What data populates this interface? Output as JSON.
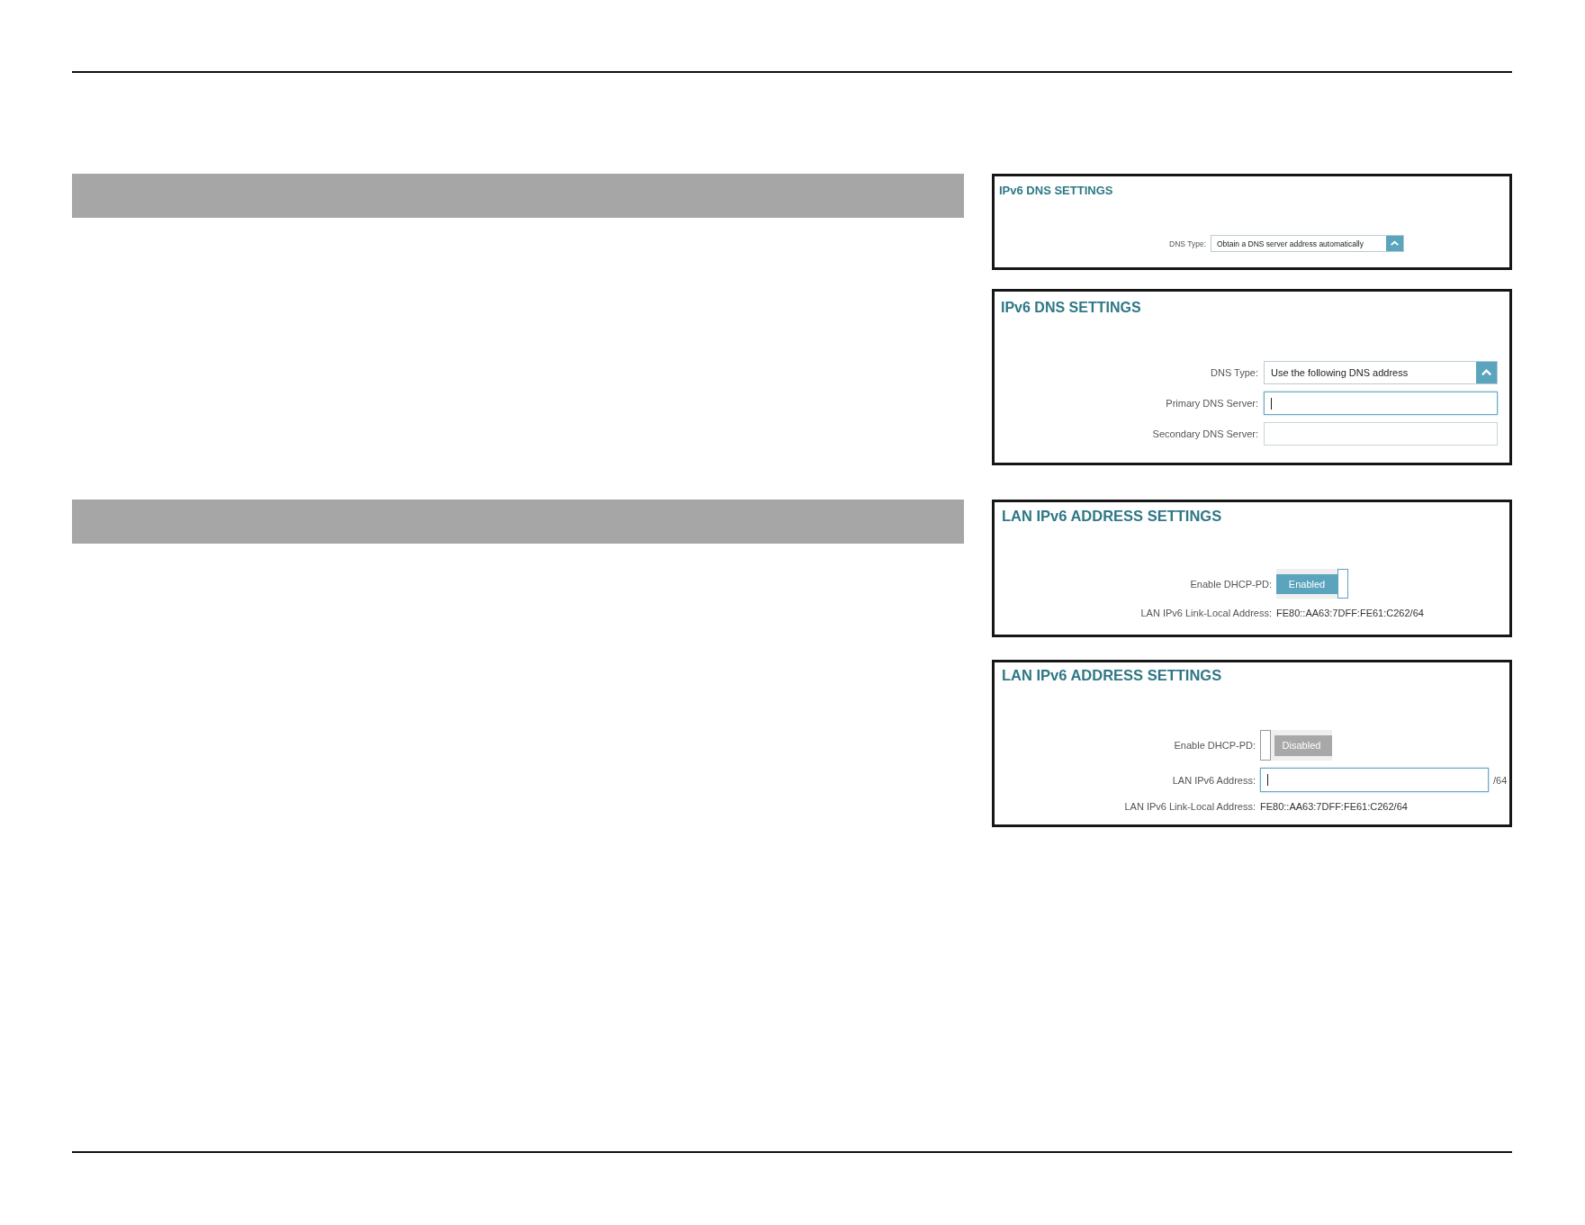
{
  "sections": [
    {
      "panels": [
        {
          "title": "IPv6 DNS SETTINGS",
          "rows": [
            {
              "kind": "select",
              "label": "DNS Type:",
              "value": "Obtain a DNS server address automatically"
            }
          ]
        },
        {
          "title": "IPv6 DNS SETTINGS",
          "rows": [
            {
              "kind": "select",
              "label": "DNS Type:",
              "value": "Use the following DNS address"
            },
            {
              "kind": "input",
              "label": "Primary DNS Server:",
              "focused": true
            },
            {
              "kind": "input",
              "label": "Secondary DNS Server:",
              "focused": false
            }
          ]
        }
      ]
    },
    {
      "panels": [
        {
          "title": "LAN IPv6 ADDRESS SETTINGS",
          "rows": [
            {
              "kind": "toggle",
              "label": "Enable DHCP-PD:",
              "on": true,
              "text": "Enabled"
            },
            {
              "kind": "info",
              "label": "LAN IPv6 Link-Local Address:",
              "value": "FE80::AA63:7DFF:FE61:C262/64"
            }
          ]
        },
        {
          "title": "LAN IPv6 ADDRESS SETTINGS",
          "rows": [
            {
              "kind": "toggle",
              "label": "Enable DHCP-PD:",
              "on": false,
              "text": "Disabled"
            },
            {
              "kind": "input",
              "label": "LAN IPv6 Address:",
              "focused": true,
              "suffix": "/64"
            },
            {
              "kind": "info",
              "label": "LAN IPv6 Link-Local Address:",
              "value": "FE80::AA63:7DFF:FE61:C262/64"
            }
          ]
        }
      ]
    }
  ]
}
